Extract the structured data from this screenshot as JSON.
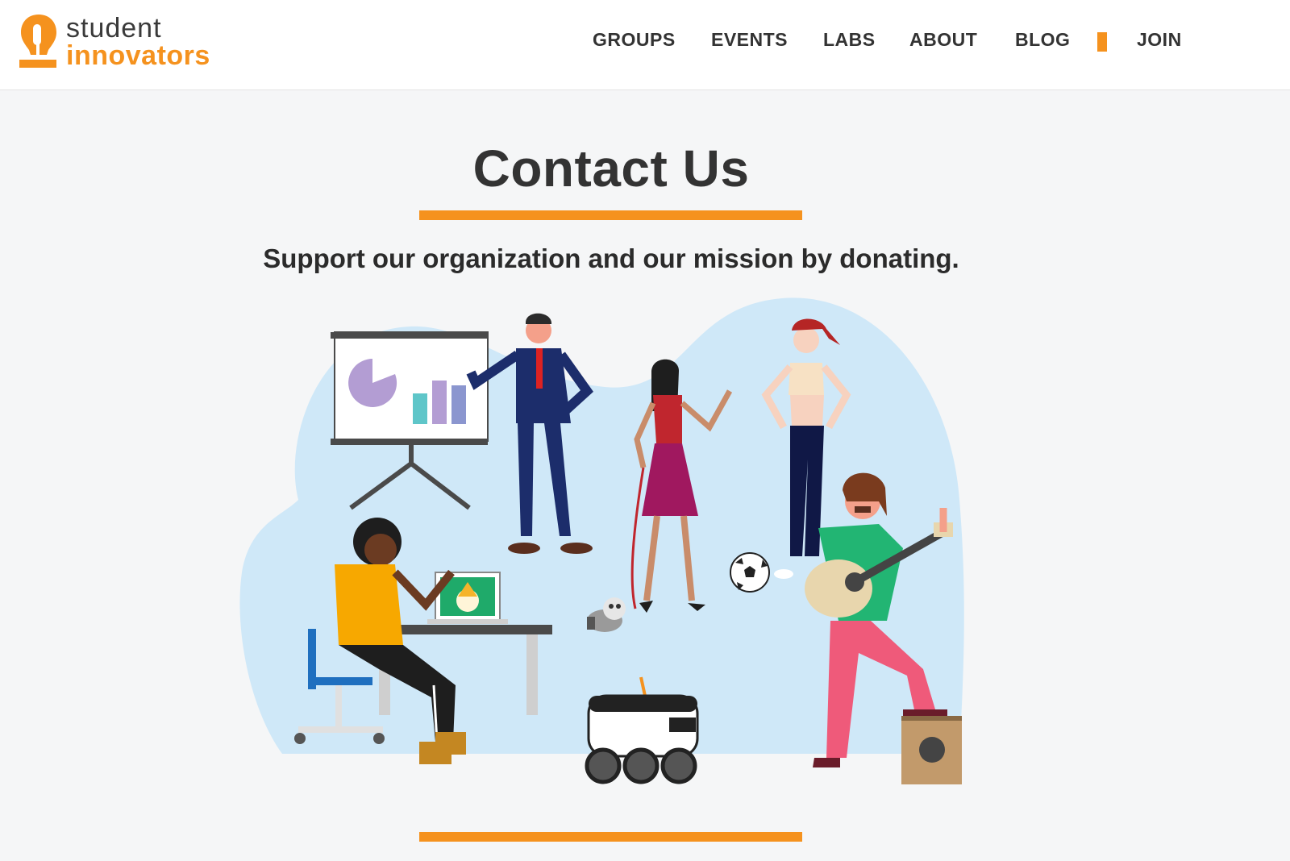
{
  "header": {
    "logo": {
      "line1": "student",
      "line2": "innovators"
    },
    "nav": [
      {
        "label": "GROUPS"
      },
      {
        "label": "EVENTS"
      },
      {
        "label": "LABS"
      },
      {
        "label": "ABOUT"
      },
      {
        "label": "BLOG"
      },
      {
        "label": "JOIN"
      }
    ]
  },
  "main": {
    "title": "Contact Us",
    "subtitle": "Support our organization and our mission by donating."
  },
  "colors": {
    "accent": "#f5921e",
    "background": "#f5f6f7",
    "text": "#333333",
    "illustration_blob": "#cfe8f8"
  },
  "illustration": {
    "name": "team-illustration",
    "icons": [
      "presentation-board-icon",
      "pie-chart-icon",
      "bar-chart-icon",
      "soccer-ball-icon",
      "delivery-robot-icon",
      "dog-icon",
      "guitar-icon",
      "laptop-icon"
    ]
  }
}
